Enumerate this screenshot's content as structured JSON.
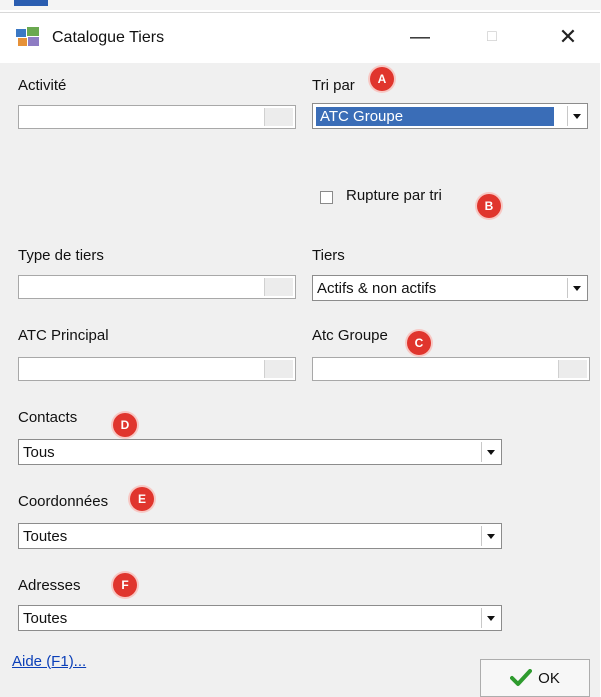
{
  "window": {
    "title": "Catalogue Tiers",
    "controls": {
      "minimize": "—",
      "maximize": "□",
      "close": "✕"
    }
  },
  "fields": {
    "activite": {
      "label": "Activité",
      "value": ""
    },
    "tri_par": {
      "label": "Tri par",
      "value": "ATC Groupe"
    },
    "rupture": {
      "label": "Rupture par tri",
      "checked": false
    },
    "type_tiers": {
      "label": "Type de tiers",
      "value": ""
    },
    "tiers": {
      "label": "Tiers",
      "value": "Actifs & non actifs"
    },
    "atc_principal": {
      "label": "ATC Principal",
      "value": ""
    },
    "atc_groupe": {
      "label": "Atc Groupe",
      "value": ""
    },
    "contacts": {
      "label": "Contacts",
      "value": "Tous"
    },
    "coordonnees": {
      "label": "Coordonnées",
      "value": "Toutes"
    },
    "adresses": {
      "label": "Adresses",
      "value": "Toutes"
    }
  },
  "markers": [
    "A",
    "B",
    "C",
    "D",
    "E",
    "F"
  ],
  "footer": {
    "help": "Aide (F1)...",
    "ok": "OK"
  },
  "colors": {
    "selection": "#3a6db7",
    "marker": "#e0352d",
    "ok_check": "#2e9b2e",
    "link": "#0b3fb8"
  }
}
